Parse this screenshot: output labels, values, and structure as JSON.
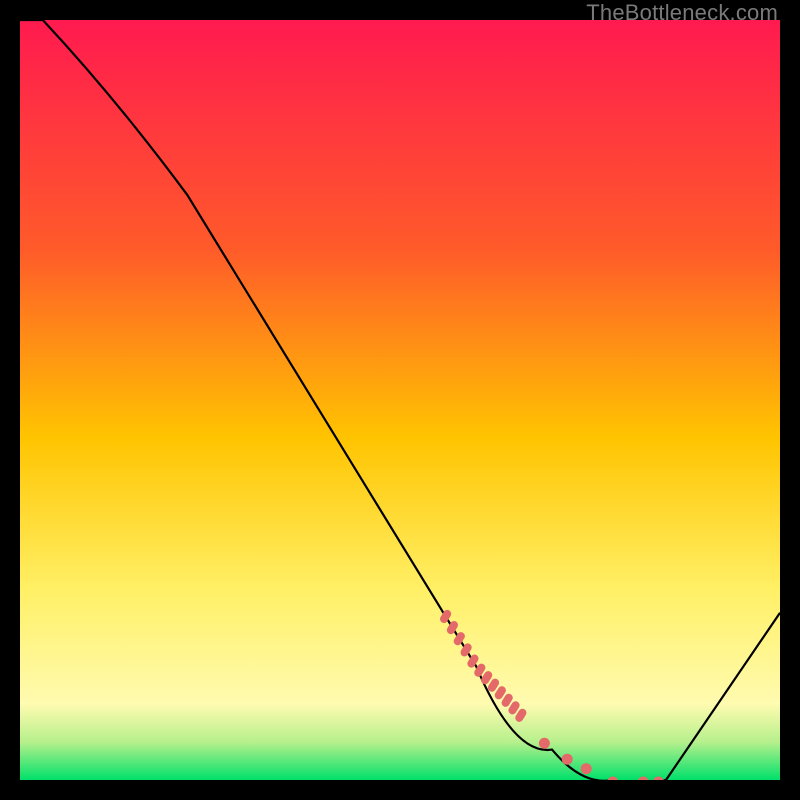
{
  "watermark": "TheBottleneck.com",
  "colors": {
    "bg_black": "#000000",
    "gradient_top": "#ff1a4f",
    "gradient_mid1": "#ff7a1a",
    "gradient_mid2": "#ffd400",
    "gradient_low": "#fff97a",
    "gradient_green": "#00e06a",
    "curve": "#000000",
    "dots": "#e46a6a"
  },
  "chart_data": {
    "type": "line",
    "title": "",
    "xlabel": "",
    "ylabel": "",
    "xlim": [
      0,
      100
    ],
    "ylim": [
      0,
      100
    ],
    "grid": false,
    "legend": false,
    "series": [
      {
        "name": "bottleneck-curve",
        "x": [
          0,
          3,
          22,
          60,
          70,
          78,
          85,
          100
        ],
        "y": [
          100,
          100,
          77,
          15,
          4,
          0,
          0,
          22
        ]
      }
    ],
    "highlight_segment": {
      "name": "salmon-dots",
      "x_start": 56,
      "x_end": 84,
      "style": "dotted-thick"
    },
    "background_gradient": {
      "stops": [
        {
          "pos": 0.0,
          "color": "#ff1a4f"
        },
        {
          "pos": 0.3,
          "color": "#ff5a2a"
        },
        {
          "pos": 0.55,
          "color": "#ffc400"
        },
        {
          "pos": 0.75,
          "color": "#fff066"
        },
        {
          "pos": 0.9,
          "color": "#fffbb0"
        },
        {
          "pos": 0.95,
          "color": "#b6f08c"
        },
        {
          "pos": 1.0,
          "color": "#00e06a"
        }
      ]
    }
  }
}
